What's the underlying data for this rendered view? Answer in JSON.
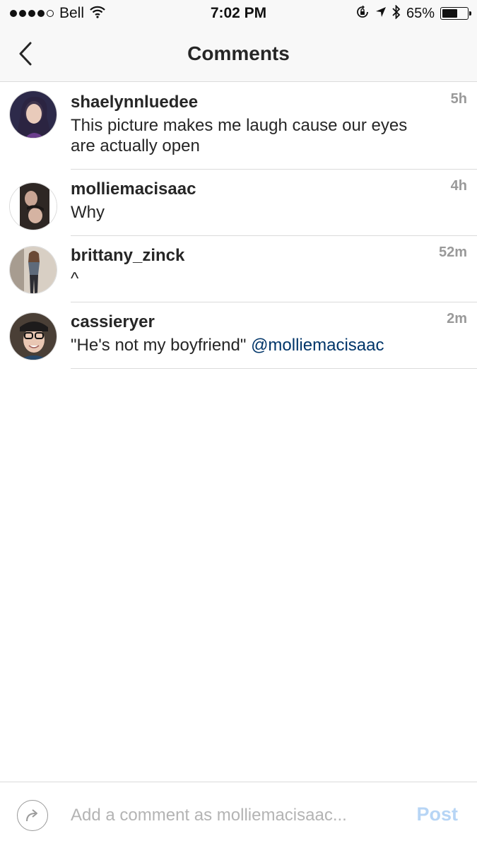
{
  "status_bar": {
    "carrier": "Bell",
    "time": "7:02 PM",
    "battery_percent": "65%",
    "battery_level": 0.65,
    "signal_bars_filled": 4,
    "signal_bars_total": 5
  },
  "nav": {
    "title": "Comments",
    "back_icon": "chevron-left-icon"
  },
  "comments": [
    {
      "username": "shaelynnluedee",
      "text": "This picture makes me laugh cause our eyes are actually open",
      "mention": "",
      "time": "5h",
      "avatar_color": "#5b4a6e"
    },
    {
      "username": "molliemacisaac",
      "text": "Why",
      "mention": "",
      "time": "4h",
      "avatar_color": "#3a3230"
    },
    {
      "username": "brittany_zinck",
      "text": "^",
      "mention": "",
      "time": "52m",
      "avatar_color": "#b9aa9e"
    },
    {
      "username": "cassieryer",
      "text": "\"He's not my boyfriend\" ",
      "mention": "@molliemacisaac",
      "time": "2m",
      "avatar_color": "#3c3a3a"
    }
  ],
  "composer": {
    "placeholder": "Add a comment as molliemacisaac...",
    "post_label": "Post",
    "share_icon": "share-arrow-icon"
  },
  "colors": {
    "mention": "#003569",
    "post_disabled": "#b7d5f5",
    "timestamp": "#999999"
  }
}
